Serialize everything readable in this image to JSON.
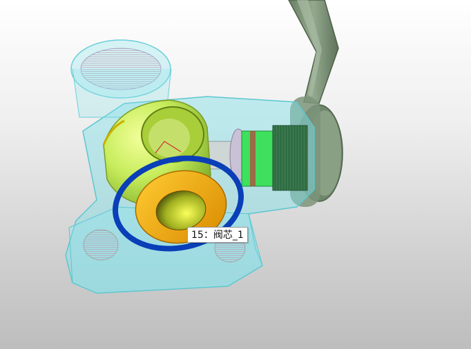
{
  "viewport": {
    "background_top": "#ffffff",
    "background_bottom": "#bdbdbd"
  },
  "model": {
    "housing_color": "#7fe0e8",
    "lever_color": "#7d947a",
    "ball_color": "#c6ec5c",
    "ring_blue_color": "#0a3fb8",
    "ring_orange_color": "#f2a600",
    "threads_color": "#2a7a4a",
    "stem_green_color": "#3ee05e"
  },
  "tooltip": {
    "text": "15：阀芯_1"
  }
}
